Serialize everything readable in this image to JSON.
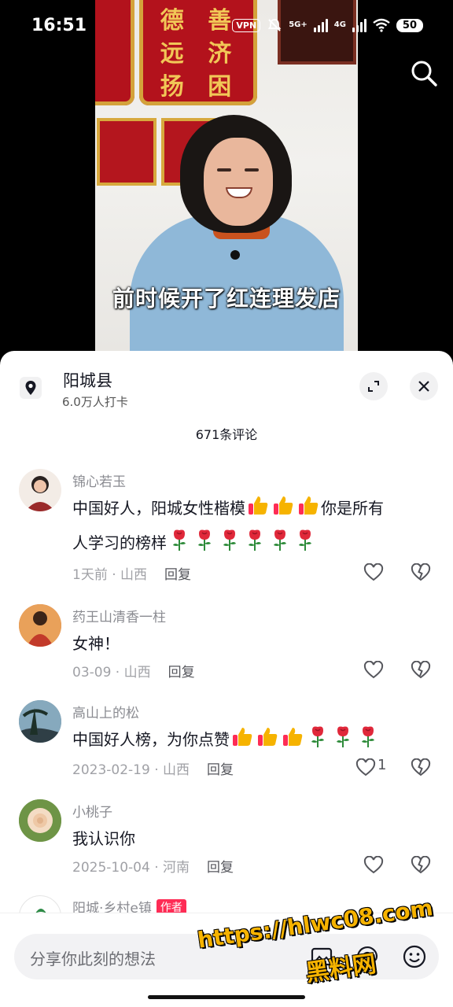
{
  "status_bar": {
    "time": "16:51",
    "vpn": "VPN",
    "network_1": "5G+",
    "network_2": "4G",
    "battery": "50"
  },
  "video": {
    "subtitle": "前时候开了红连理发店",
    "banner_text": "德 善 远 济 扬 困"
  },
  "location": {
    "title": "阳城县",
    "subtitle": "6.0万人打卡"
  },
  "comments_count": "671条评论",
  "comments": [
    {
      "user": "锦心若玉",
      "text_1": "中国好人，阳城女性楷模",
      "text_2": "你是所有",
      "text_3": "人学习的榜样",
      "time": "1天前",
      "region": "山西",
      "reply": "回复",
      "likes": ""
    },
    {
      "user": "药王山清香一柱",
      "text": "女神！",
      "time": "03-09",
      "region": "山西",
      "reply": "回复",
      "likes": ""
    },
    {
      "user": "高山上的松",
      "text": "中国好人榜，为你点赞",
      "time": "2023-02-19",
      "region": "山西",
      "reply": "回复",
      "likes": "1"
    },
    {
      "user": "小桃子",
      "text": "我认识你",
      "time": "2025-10-04",
      "region": "河南",
      "reply": "回复",
      "likes": ""
    },
    {
      "user": "阳城·乡村e镇",
      "author_tag": "作者"
    }
  ],
  "input": {
    "placeholder": "分享你此刻的想法"
  },
  "watermark": {
    "line1": "https://hlwc08.com",
    "line2": "黑料网"
  },
  "colors": {
    "accent": "#fe2c55",
    "thumb": "#f6b300",
    "rose": "#e0283a"
  }
}
